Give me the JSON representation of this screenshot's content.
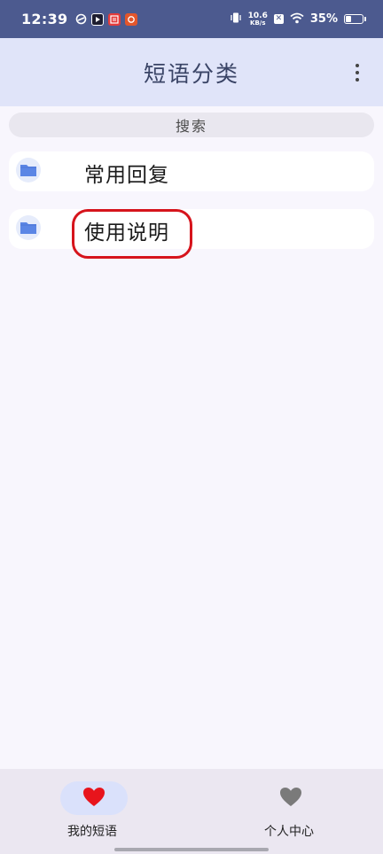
{
  "status_bar": {
    "time": "12:39",
    "net_speed_value": "10.6",
    "net_speed_unit": "KB/s",
    "battery_text": "35%",
    "battery_level": 0.35,
    "app_icons": [
      "sync-app-icon",
      "video-app-icon",
      "news-app-icon",
      "reader-app-icon"
    ]
  },
  "header": {
    "title": "短语分类",
    "menu_icon": "more-vertical-icon"
  },
  "search": {
    "label": "搜索"
  },
  "categories": [
    {
      "label": "常用回复",
      "icon": "folder-icon",
      "icon_color": "#5b86e5"
    },
    {
      "label": "使用说明",
      "icon": "folder-icon",
      "icon_color": "#5b86e5",
      "highlighted": true
    }
  ],
  "highlight_color": "#d6141c",
  "bottom_nav": {
    "items": [
      {
        "label": "我的短语",
        "icon": "heart-icon",
        "icon_color": "#e8141c",
        "active": true
      },
      {
        "label": "个人中心",
        "icon": "heart-icon",
        "icon_color": "#7a7a7a",
        "active": false
      }
    ]
  }
}
